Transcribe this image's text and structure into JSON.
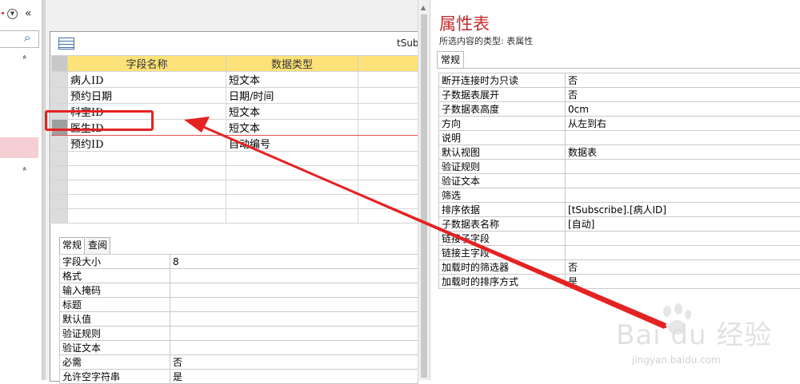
{
  "nav": {
    "collapse_glyph": "«",
    "chevron": "»"
  },
  "table_tab": {
    "title": "tSub"
  },
  "design_grid": {
    "headers": [
      "字段名称",
      "数据类型"
    ],
    "rows": [
      {
        "name": "病人ID",
        "type": "短文本"
      },
      {
        "name": "预约日期",
        "type": "日期/时间"
      },
      {
        "name": "科室ID",
        "type": "短文本"
      },
      {
        "name": "医生ID",
        "type": "短文本"
      },
      {
        "name": "预约ID",
        "type": "自动编号"
      }
    ]
  },
  "field_properties": {
    "tabs": [
      "常规",
      "查阅"
    ],
    "rows": [
      {
        "label": "字段大小",
        "value": "8"
      },
      {
        "label": "格式",
        "value": ""
      },
      {
        "label": "输入掩码",
        "value": ""
      },
      {
        "label": "标题",
        "value": ""
      },
      {
        "label": "默认值",
        "value": ""
      },
      {
        "label": "验证规则",
        "value": ""
      },
      {
        "label": "验证文本",
        "value": ""
      },
      {
        "label": "必需",
        "value": "否"
      },
      {
        "label": "允许空字符串",
        "value": "是"
      }
    ]
  },
  "property_sheet": {
    "title": "属性表",
    "selection_type": "所选内容的类型: 表属性",
    "tab": "常规",
    "rows": [
      {
        "label": "断开连接时为只读",
        "value": "否"
      },
      {
        "label": "子数据表展开",
        "value": "否"
      },
      {
        "label": "子数据表高度",
        "value": "0cm"
      },
      {
        "label": "方向",
        "value": "从左到右"
      },
      {
        "label": "说明",
        "value": ""
      },
      {
        "label": "默认视图",
        "value": "数据表"
      },
      {
        "label": "验证规则",
        "value": ""
      },
      {
        "label": "验证文本",
        "value": ""
      },
      {
        "label": "筛选",
        "value": ""
      },
      {
        "label": "排序依据",
        "value": "[tSubscribe].[病人ID]"
      },
      {
        "label": "子数据表名称",
        "value": "[自动]"
      },
      {
        "label": "链接子字段",
        "value": ""
      },
      {
        "label": "链接主字段",
        "value": ""
      },
      {
        "label": "加载时的筛选器",
        "value": "否"
      },
      {
        "label": "加载时的排序方式",
        "value": "是"
      }
    ]
  },
  "watermark": {
    "logo": "Bai du 经验",
    "url": "jingyan.baidu.com"
  },
  "colors": {
    "accent_red": "#e52222",
    "header_yellow": "#fde27a",
    "title_red": "#c42b2b"
  }
}
